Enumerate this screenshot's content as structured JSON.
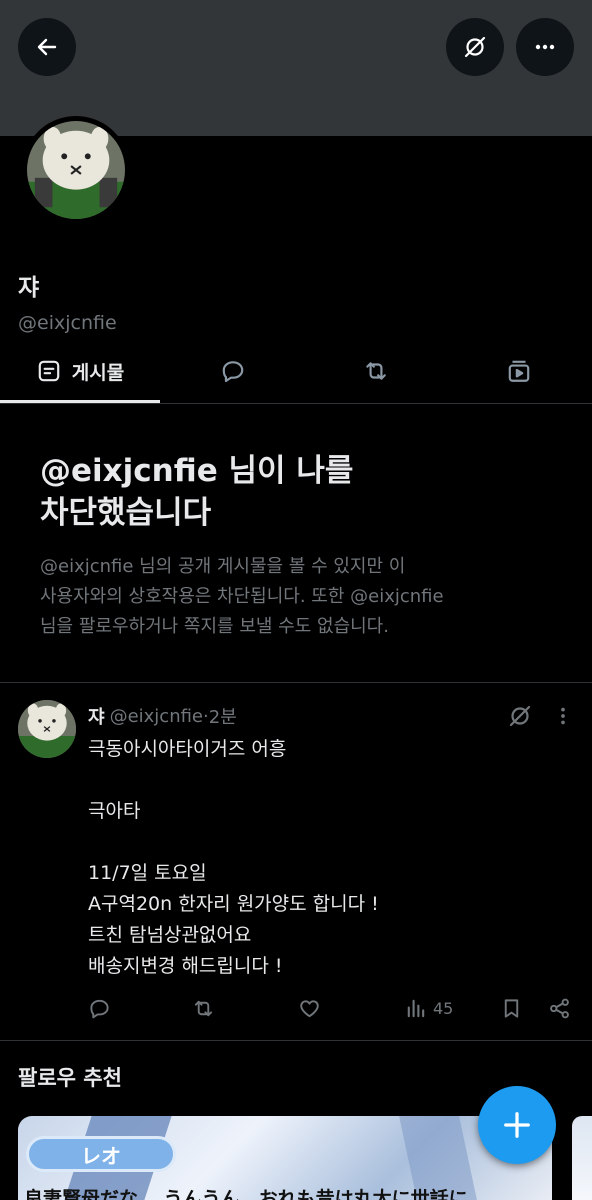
{
  "profile": {
    "display_name": "쟈",
    "handle": "@eixjcnfie"
  },
  "header": {
    "back_icon": "arrow-left-icon",
    "grok_icon": "grok-icon",
    "more_icon": "more-icon"
  },
  "tabs": [
    {
      "label": "게시물",
      "icon": "posts-icon",
      "selected": true
    },
    {
      "label": "",
      "icon": "reply-icon"
    },
    {
      "label": "",
      "icon": "repost-icon"
    },
    {
      "label": "",
      "icon": "media-icon"
    }
  ],
  "blocked": {
    "title_line1": "@eixjcnfie 님이 나를",
    "title_line2": "차단했습니다",
    "desc_line1": "@eixjcnfie 님의 공개 게시물을 볼 수 있지만 이",
    "desc_line2": "사용자와의 상호작용은 차단됩니다. 또한 @eixjcnfie",
    "desc_line3": "님을 팔로우하거나 쪽지를 보낼 수도 없습니다."
  },
  "tweet": {
    "name": "쟈",
    "handle": "@eixjcnfie",
    "dot": "·",
    "time": "2분",
    "lines": [
      "극동아시아타이거즈 어흥",
      "",
      "극아타",
      "",
      "11/7일 토요일",
      "A구역20n 한자리 원가양도 합니다 !",
      "트친 탐넘상관없어요",
      "배송지변경 해드립니다 !"
    ],
    "views": "45"
  },
  "follow_section": {
    "title": "팔로우 추천"
  },
  "card": {
    "badge": "レオ",
    "caption": "良妻賢母だな… うんうん、おれも昔は丸太に世話に"
  },
  "colors": {
    "accent": "#1d9bf0",
    "banner": "#333639",
    "muted": "#71767b",
    "text": "#e7e9ea"
  }
}
